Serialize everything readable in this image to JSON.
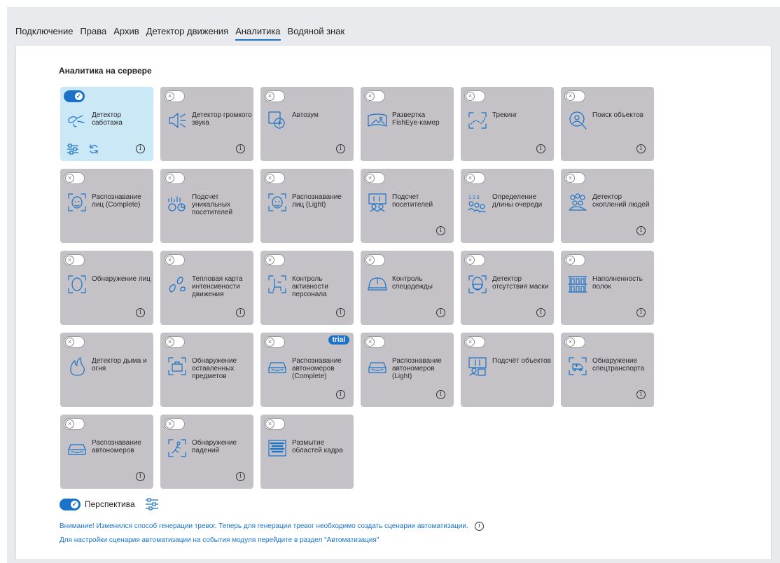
{
  "tabs": [
    {
      "label": "Подключение",
      "active": false
    },
    {
      "label": "Права",
      "active": false
    },
    {
      "label": "Архив",
      "active": false
    },
    {
      "label": "Детектор движения",
      "active": false
    },
    {
      "label": "Аналитика",
      "active": true
    },
    {
      "label": "Водяной знак",
      "active": false
    }
  ],
  "section": {
    "title": "Аналитика на сервере"
  },
  "colors": {
    "accent": "#1a73c9",
    "card_inactive": "#c4c2c6",
    "card_active": "#cbe8f6"
  },
  "modules": [
    {
      "label": "Детектор саботажа",
      "icon": "sabotage-icon",
      "enabled": true,
      "info": true,
      "settings": true
    },
    {
      "label": "Детектор громкого звука",
      "icon": "loud-sound-icon",
      "enabled": false,
      "info": true
    },
    {
      "label": "Автозум",
      "icon": "autozoom-icon",
      "enabled": false,
      "info": true
    },
    {
      "label": "Развертка FishEye-камер",
      "icon": "fisheye-icon",
      "enabled": false,
      "info": false
    },
    {
      "label": "Трекинг",
      "icon": "tracking-icon",
      "enabled": false,
      "info": true
    },
    {
      "label": "Поиск объектов",
      "icon": "object-search-icon",
      "enabled": false,
      "info": true
    },
    {
      "label": "Распознавание лиц (Complete)",
      "icon": "face-recognition-icon",
      "enabled": false,
      "info": false
    },
    {
      "label": "Подсчет уникальных посетителей",
      "icon": "unique-visitors-icon",
      "enabled": false,
      "info": false
    },
    {
      "label": "Распознавание лиц (Light)",
      "icon": "face-recognition-icon",
      "enabled": false,
      "info": false
    },
    {
      "label": "Подсчет посетителей",
      "icon": "visitor-count-icon",
      "enabled": false,
      "info": true
    },
    {
      "label": "Определение длины очереди",
      "icon": "queue-length-icon",
      "enabled": false,
      "info": false
    },
    {
      "label": "Детектор скоплений людей",
      "icon": "crowd-icon",
      "enabled": false,
      "info": true
    },
    {
      "label": "Обнаружение лиц",
      "icon": "face-detection-icon",
      "enabled": false,
      "info": true
    },
    {
      "label": "Тепловая карта интенсивности движения",
      "icon": "heatmap-icon",
      "enabled": false,
      "info": true
    },
    {
      "label": "Контроль активности персонала",
      "icon": "staff-activity-icon",
      "enabled": false,
      "info": true
    },
    {
      "label": "Контроль спецодежды",
      "icon": "helmet-icon",
      "enabled": false,
      "info": true
    },
    {
      "label": "Детектор отсутствия маски",
      "icon": "mask-icon",
      "enabled": false,
      "info": true
    },
    {
      "label": "Наполненность полок",
      "icon": "shelves-icon",
      "enabled": false,
      "info": true
    },
    {
      "label": "Детектор дыма и огня",
      "icon": "fire-icon",
      "enabled": false,
      "info": false
    },
    {
      "label": "Обнаружение оставленных предметов",
      "icon": "abandoned-object-icon",
      "enabled": false,
      "info": false
    },
    {
      "label": "Распознавание автономеров (Complete)",
      "icon": "car-icon",
      "enabled": false,
      "info": true,
      "badge": "trial"
    },
    {
      "label": "Распознавание автономеров (Light)",
      "icon": "car-icon",
      "enabled": false,
      "info": true
    },
    {
      "label": "Подсчёт объектов",
      "icon": "object-count-icon",
      "enabled": false,
      "info": false
    },
    {
      "label": "Обнаружение спецтранспорта",
      "icon": "special-vehicle-icon",
      "enabled": false,
      "info": true
    },
    {
      "label": "Распознавание автономеров",
      "icon": "car-icon",
      "enabled": false,
      "info": true
    },
    {
      "label": "Обнаружение падений",
      "icon": "fall-icon",
      "enabled": false,
      "info": true
    },
    {
      "label": "Размытие областей кадра",
      "icon": "blur-icon",
      "enabled": false,
      "info": false
    }
  ],
  "perspective": {
    "label": "Перспектива",
    "enabled": true
  },
  "warning": "Внимание! Изменился способ генерации тревог. Теперь для генерации тревог необходимо создать сценарии автоматизации.",
  "hint": "Для настройки сценария автоматизации на события модуля перейдите в раздел \"Автоматизация\""
}
